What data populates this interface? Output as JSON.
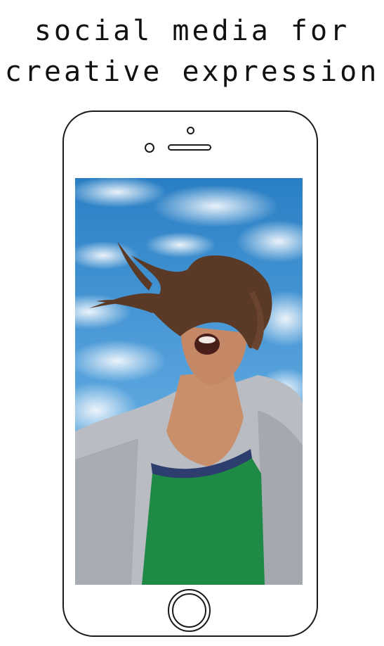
{
  "headline": {
    "line1": "social media for",
    "line2": "creative expression"
  },
  "phone": {
    "home_button_icon": "home-button-circle",
    "screen_photo": "woman-hair-blowing-sky-photo"
  },
  "colors": {
    "outline": "#1a1a1a",
    "sky": "#4a9ad8",
    "cloud": "#e8f1f8",
    "hair": "#5a3a26",
    "jacket": "#b9bcc2",
    "shirt": "#1f8a45",
    "skin": "#c98f6b"
  }
}
